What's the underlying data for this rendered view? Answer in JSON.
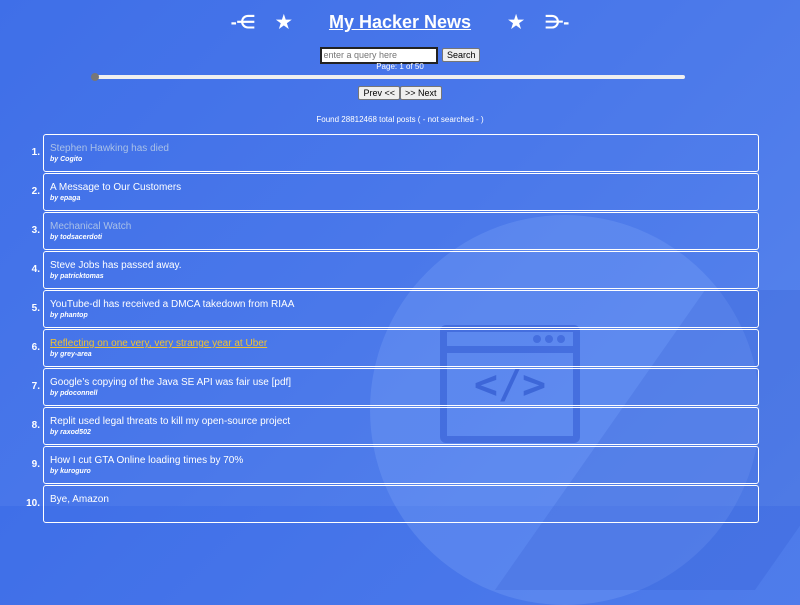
{
  "header": {
    "left_arrow": "-⋲",
    "left_star": "★",
    "title": "My Hacker News",
    "right_star": "★",
    "right_arrow": "⋺-"
  },
  "search": {
    "placeholder": "enter a query here",
    "value": "",
    "button_label": "Search"
  },
  "page_indicator": "Page: 1 of 50",
  "slider": {
    "value": 1,
    "min": 1,
    "max": 50
  },
  "pager": {
    "prev_label": "Prev <<",
    "next_label": ">> Next"
  },
  "found_text": "Found 28812468 total posts ( - not searched - )",
  "background_icon": {
    "name": "code-window-icon",
    "glyph": "</>"
  },
  "colors": {
    "background": "#4a78ea",
    "visited_link": "#a9c0e8",
    "hover_link": "#f2c230",
    "text": "#ffffff"
  },
  "posts": [
    {
      "rank": "1.",
      "title": "Stephen Hawking has died",
      "author": "by Cogito",
      "state": "visited"
    },
    {
      "rank": "2.",
      "title": "A Message to Our Customers",
      "author": "by epaga",
      "state": "normal"
    },
    {
      "rank": "3.",
      "title": "Mechanical Watch",
      "author": "by todsacerdoti",
      "state": "visited"
    },
    {
      "rank": "4.",
      "title": "Steve Jobs has passed away.",
      "author": "by patricktomas",
      "state": "normal"
    },
    {
      "rank": "5.",
      "title": "YouTube-dl has received a DMCA takedown from RIAA",
      "author": "by phantop",
      "state": "normal"
    },
    {
      "rank": "6.",
      "title": "Reflecting on one very, very strange year at Uber",
      "author": "by grey-area",
      "state": "hover"
    },
    {
      "rank": "7.",
      "title": "Google’s copying of the Java SE API was fair use [pdf]",
      "author": "by pdoconnell",
      "state": "normal"
    },
    {
      "rank": "8.",
      "title": "Replit used legal threats to kill my open-source project",
      "author": "by raxod502",
      "state": "normal"
    },
    {
      "rank": "9.",
      "title": "How I cut GTA Online loading times by 70%",
      "author": "by kuroguro",
      "state": "normal"
    },
    {
      "rank": "10.",
      "title": "Bye, Amazon",
      "author": "",
      "state": "normal"
    }
  ]
}
